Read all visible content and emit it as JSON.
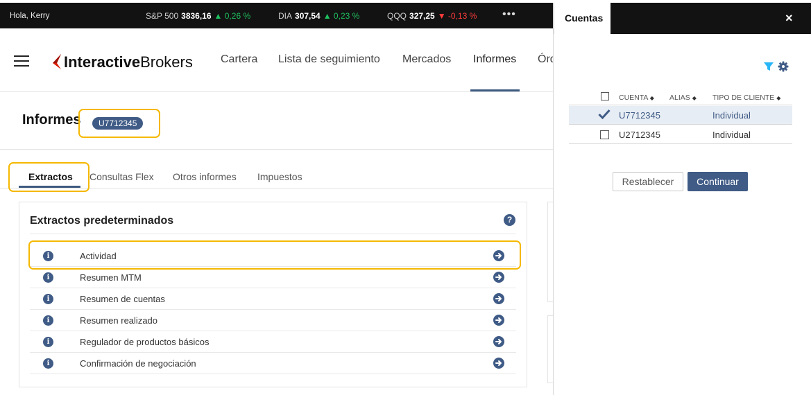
{
  "ticker": {
    "greeting": "Hola, Kerry",
    "items": [
      {
        "symbol": "S&P 500",
        "value": "3836,16",
        "change": "▲ 0,26 %",
        "direction": "up"
      },
      {
        "symbol": "DIA",
        "value": "307,54",
        "change": "▲ 0,23 %",
        "direction": "up"
      },
      {
        "symbol": "QQQ",
        "value": "327,25",
        "change": "▼ -0,13 %",
        "direction": "down"
      }
    ],
    "more": "•••"
  },
  "header": {
    "logo_bold": "Interactive",
    "logo_regular": "Brokers",
    "nav": [
      "Cartera",
      "Lista de seguimiento",
      "Mercados",
      "Informes",
      "Órdenes"
    ],
    "active_nav": "Informes"
  },
  "page": {
    "title": "Informes",
    "account_badge": "U7712345"
  },
  "tabs": [
    "Extractos",
    "Consultas Flex",
    "Otros informes",
    "Impuestos"
  ],
  "statements_card": {
    "title": "Extractos predeterminados",
    "help": "?",
    "info_glyph": "i",
    "rows": [
      "Actividad",
      "Resumen MTM",
      "Resumen de cuentas",
      "Resumen realizado",
      "Regulador de productos básicos",
      "Confirmación de negociación"
    ]
  },
  "accounts_panel": {
    "tab_label": "Cuentas",
    "close": "×",
    "columns": {
      "account": "CUENTA",
      "alias": "ALIAS",
      "client_type": "TIPO DE CLIENTE"
    },
    "sort_glyph": "◆",
    "rows": [
      {
        "account": "U7712345",
        "client_type": "Individual",
        "selected": true
      },
      {
        "account": "U2712345",
        "client_type": "Individual",
        "selected": false
      }
    ],
    "reset_label": "Restablecer",
    "continue_label": "Continuar"
  },
  "colors": {
    "accent": "#3f5b86",
    "highlight": "#f5b800",
    "up": "#1fbf5f",
    "down": "#ff3b3b",
    "filter": "#29b6f6"
  }
}
